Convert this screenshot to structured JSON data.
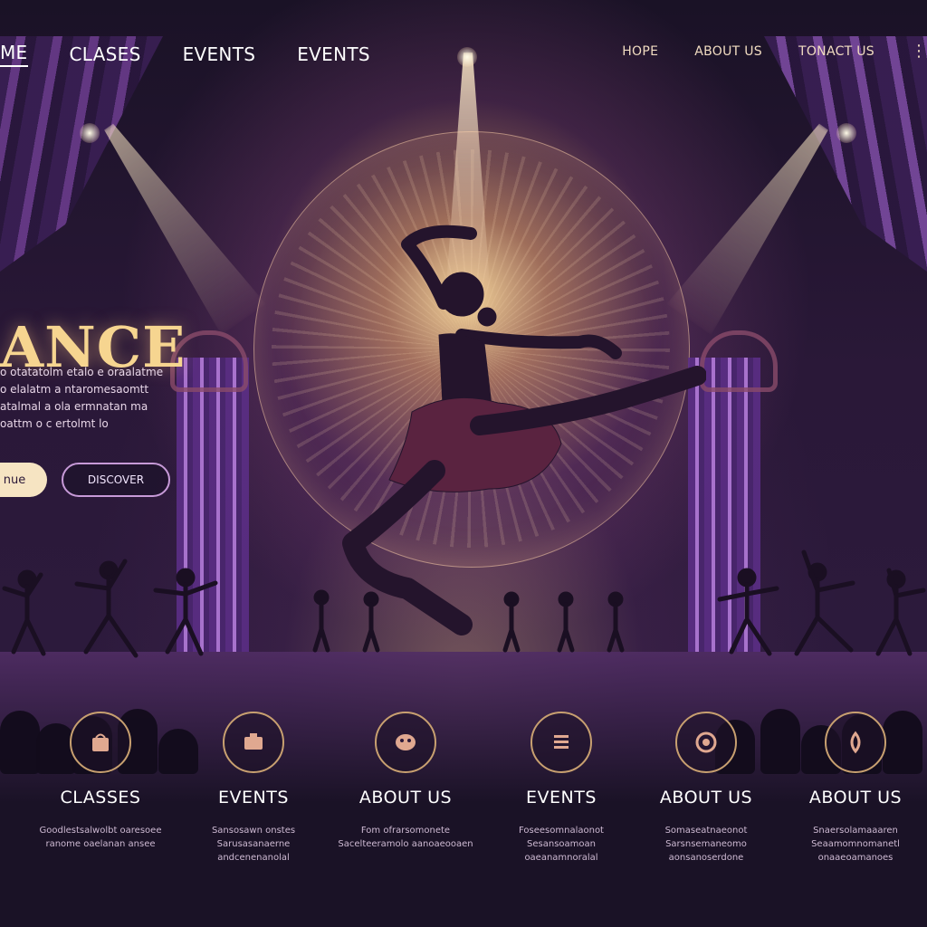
{
  "nav": {
    "left": [
      {
        "label": "ME",
        "active": true
      },
      {
        "label": "CLASES",
        "active": false
      },
      {
        "label": "EVENTS",
        "active": false
      },
      {
        "label": "EVENTS",
        "active": false
      }
    ],
    "right": [
      {
        "label": "HOPE"
      },
      {
        "label": "ABOUT US"
      },
      {
        "label": "TONACT US"
      }
    ],
    "more_icon": "ellipsis-icon"
  },
  "hero": {
    "title": "ANCE",
    "text": "o otatatolm etalo e oraalatme o elalatm a ntaromesaomtt atalmal a ola ermnatan ma oattm o c ertolmt lo",
    "primary_button": "nue",
    "secondary_button": "DISCOVER"
  },
  "features": [
    {
      "title": "CLASSES",
      "icon": "bag-icon",
      "text": "Goodlestsalwolbt oaresoee ranome oaelanan ansee"
    },
    {
      "title": "EVENTS",
      "icon": "box-icon",
      "text": "Sansosawn onstes Sarusasanaerne andcenenanolal"
    },
    {
      "title": "ABOUT US",
      "icon": "mask-icon",
      "text": "Fom ofrarsomonete Sacelteeramolo aanoaeooaen"
    },
    {
      "title": "EVENTS",
      "icon": "list-icon",
      "text": "Foseesomnalaonot Sesansoamoan oaeanamnoralal"
    },
    {
      "title": "ABOUT US",
      "icon": "seal-icon",
      "text": "Somaseatnaeonot Sarsnsemaneomo aonsanoserdone"
    },
    {
      "title": "ABOUT US",
      "icon": "drop-icon",
      "text": "Snaersolamaaaren Seaamomnomanetl onaaeoamanoes"
    }
  ],
  "colors": {
    "accent_gold": "#f6d590",
    "background": "#1c1428",
    "purple": "#7a4aa0"
  }
}
